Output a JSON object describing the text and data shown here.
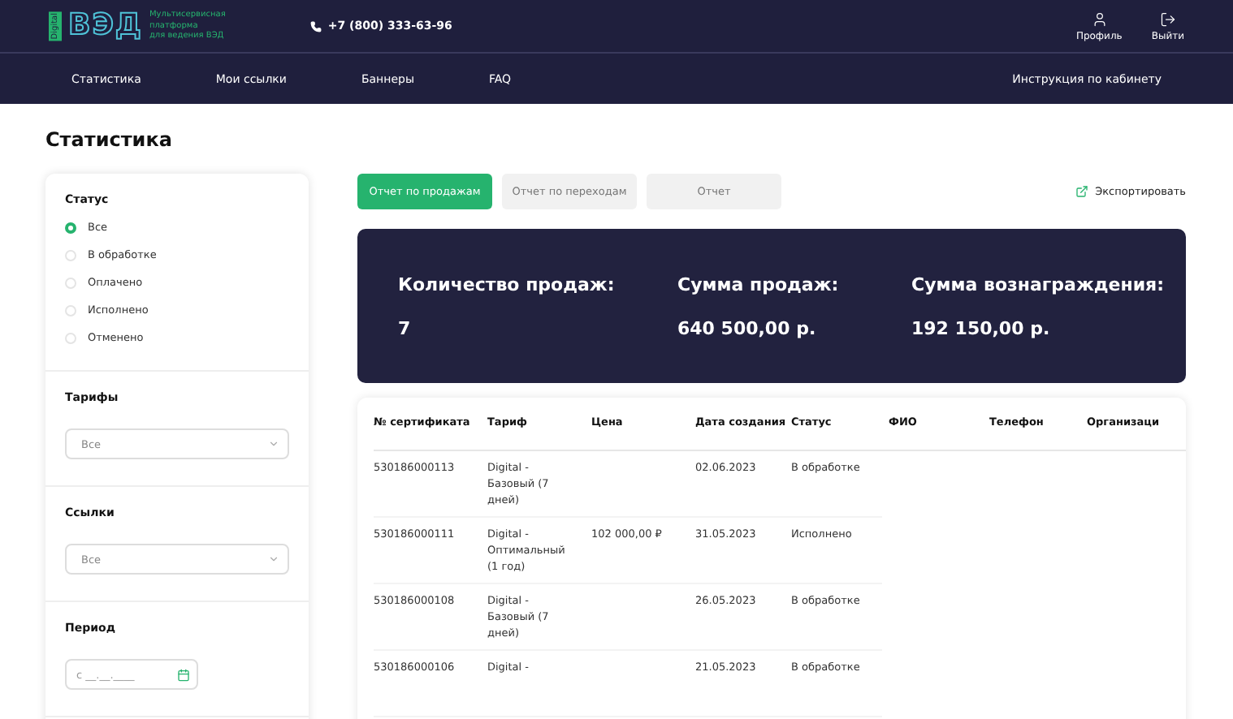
{
  "header": {
    "logo": "ВЭД",
    "logo_badge": "Digital",
    "tagline": [
      "Мультисервисная",
      "платформа",
      "для ведения ВЭД"
    ],
    "phone": "+7 (800) 333-63-96",
    "actions": [
      {
        "kind": "profile",
        "label": "Профиль"
      },
      {
        "kind": "logout",
        "label": "Выйти"
      }
    ]
  },
  "nav": {
    "items": [
      "Статистика",
      "Мои ссылки",
      "Баннеры",
      "FAQ"
    ],
    "help": "Инструкция по кабинету"
  },
  "page_title": "Статистика",
  "filters": {
    "status": {
      "title": "Статус",
      "options": [
        {
          "label": "Все",
          "selected": true
        },
        {
          "label": "В обработке",
          "selected": false
        },
        {
          "label": "Оплачено",
          "selected": false
        },
        {
          "label": "Исполнено",
          "selected": false
        },
        {
          "label": "Отменено",
          "selected": false
        }
      ]
    },
    "selects": [
      {
        "title": "Тарифы",
        "placeholder": "Все"
      },
      {
        "title": "Ссылки",
        "placeholder": "Все"
      }
    ],
    "period": {
      "title": "Период",
      "placeholder": "с __.__.____"
    }
  },
  "tabs": [
    {
      "label": "Отчет по продажам",
      "selected": true
    },
    {
      "label": "Отчет по переходам",
      "selected": false
    },
    {
      "label": "Отчет",
      "selected": false
    }
  ],
  "export": "Экспортировать",
  "summary": [
    {
      "label": "Количество продаж:",
      "value": "7"
    },
    {
      "label": "Сумма продаж:",
      "value": "640 500,00 р."
    },
    {
      "label": "Сумма вознаграждения:",
      "value": "192 150,00 р."
    }
  ],
  "table": {
    "columns": [
      "№ сертификата",
      "Тариф",
      "Цена",
      "Дата создания",
      "Статус",
      "ФИО",
      "Телефон",
      "Организаци"
    ],
    "rows": [
      [
        "530186000113",
        "Digital - Базовый (7 дней)",
        "",
        "02.06.2023",
        "В обработке"
      ],
      [
        "530186000111",
        "Digital - Оптимальный (1 год)",
        "102 000,00 ₽",
        "31.05.2023",
        "Исполнено"
      ],
      [
        "530186000108",
        "Digital - Базовый (7 дней)",
        "",
        "26.05.2023",
        "В обработке"
      ],
      [
        "530186000106",
        "Digital -",
        "",
        "21.05.2023",
        "В обработке"
      ]
    ]
  }
}
